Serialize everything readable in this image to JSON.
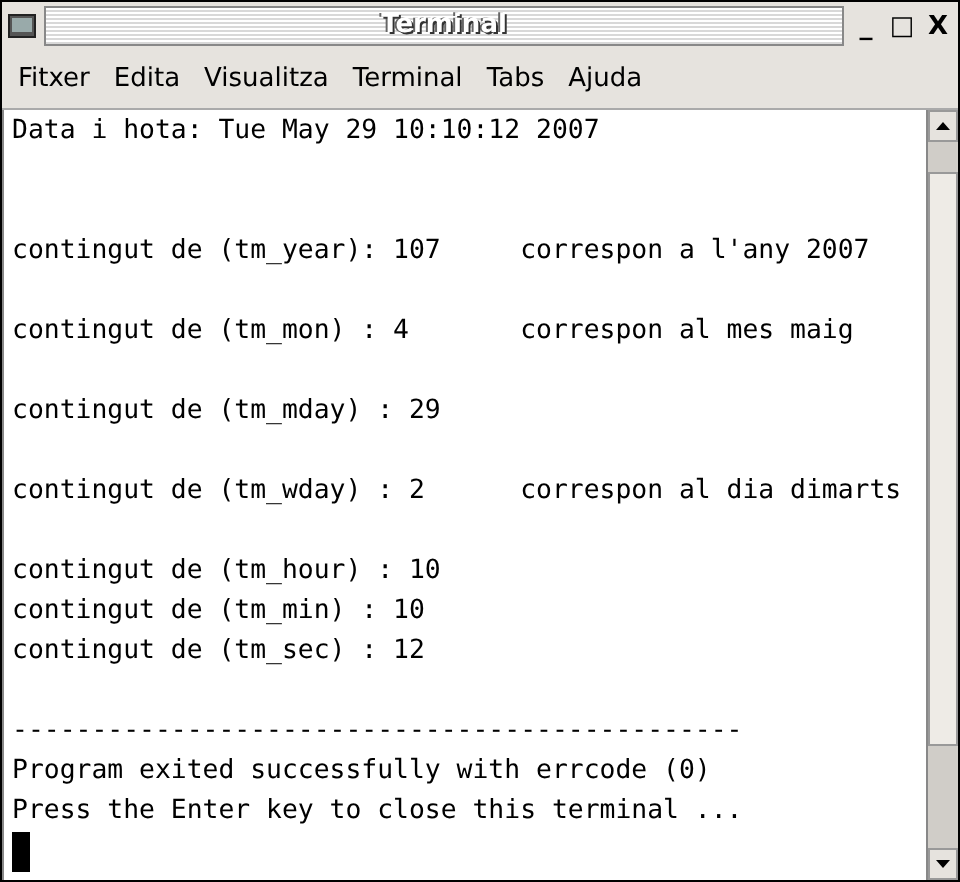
{
  "window": {
    "title": "Terminal",
    "controls": [
      "_",
      "□",
      "X"
    ]
  },
  "menu": [
    "Fitxer",
    "Edita",
    "Visualitza",
    "Terminal",
    "Tabs",
    "Ajuda"
  ],
  "terminal": {
    "lines": [
      {
        "kind": "text",
        "text": "Data i hota: Tue May 29 10:10:12 2007"
      },
      {
        "kind": "blank"
      },
      {
        "kind": "blank"
      },
      {
        "kind": "text",
        "text": "contingut de (tm_year): 107",
        "note": "correspon a l'any 2007"
      },
      {
        "kind": "blank"
      },
      {
        "kind": "text",
        "text": "contingut de (tm_mon) : 4",
        "note": "correspon al mes maig"
      },
      {
        "kind": "blank"
      },
      {
        "kind": "text",
        "text": "contingut de (tm_mday) : 29"
      },
      {
        "kind": "blank"
      },
      {
        "kind": "text",
        "text": "contingut de (tm_wday) : 2",
        "note": "correspon al dia dimarts"
      },
      {
        "kind": "blank"
      },
      {
        "kind": "text",
        "text": "contingut de (tm_hour) : 10"
      },
      {
        "kind": "text",
        "text": "contingut de (tm_min) : 10"
      },
      {
        "kind": "text",
        "text": "contingut de (tm_sec) : 12"
      },
      {
        "kind": "blank"
      },
      {
        "kind": "text",
        "text": "----------------------------------------------"
      },
      {
        "kind": "text",
        "text": "Program exited successfully with errcode (0)"
      },
      {
        "kind": "text",
        "text": "Press the Enter key to close this terminal ..."
      },
      {
        "kind": "cursor"
      }
    ]
  }
}
